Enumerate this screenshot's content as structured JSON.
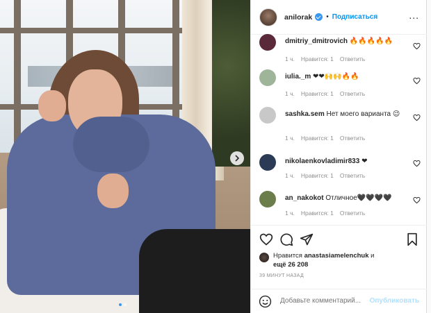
{
  "post": {
    "photo_description_icon": "photo",
    "next_icon": "chevron-right-icon",
    "slide_count": 2,
    "active_slide": 1
  },
  "header": {
    "username": "anilorak",
    "verified_icon": "verified-badge-icon",
    "separator": "•",
    "follow_label": "Подписаться",
    "more_label": "..."
  },
  "comments": [
    {
      "username": "dmitriy_dmitrovich",
      "text": "🔥🔥🔥🔥🔥",
      "age": "1 ч.",
      "likes": "Нравится: 1",
      "reply": "Ответить",
      "avatar_color": "#5a2a3a"
    },
    {
      "username": "iulia._m",
      "text": "❤❤🙌🙌🔥🔥",
      "age": "1 ч.",
      "likes": "Нравится: 1",
      "reply": "Ответить",
      "avatar_color": "#9fb59a"
    },
    {
      "username": "sashka.sem",
      "text": "Нет моего варианта 😉",
      "age": "1 ч.",
      "likes": "Нравится: 1",
      "reply": "Ответить",
      "avatar_color": "#c8c8c8"
    },
    {
      "username": "nikolaenkovladimir833",
      "text": "❤",
      "age": "1 ч.",
      "likes": "Нравится: 1",
      "reply": "Ответить",
      "avatar_color": "#2b3a55"
    },
    {
      "username": "an_nakokot",
      "text": "Отличное🖤🖤🖤🖤",
      "age": "1 ч.",
      "likes": "Нравится: 1",
      "reply": "Ответить",
      "avatar_color": "#6a7d4a"
    }
  ],
  "actions": {
    "like_icon": "heart-outline-icon",
    "comment_icon": "comment-icon",
    "share_icon": "send-icon",
    "save_icon": "bookmark-icon"
  },
  "likes": {
    "prefix": "Нравится",
    "user": "anastasiamelenchuk",
    "suffix": "и",
    "more": "ещё 26 208"
  },
  "timestamp": "39 МИНУТ НАЗАД",
  "add_comment": {
    "emoji_icon": "smile-icon",
    "placeholder": "Добавьте комментарий...",
    "publish_label": "Опубликовать"
  },
  "colors": {
    "accent": "#0095f6",
    "publish_disabled": "#b2dffc",
    "muted": "#8e8e8e",
    "text": "#262626"
  }
}
